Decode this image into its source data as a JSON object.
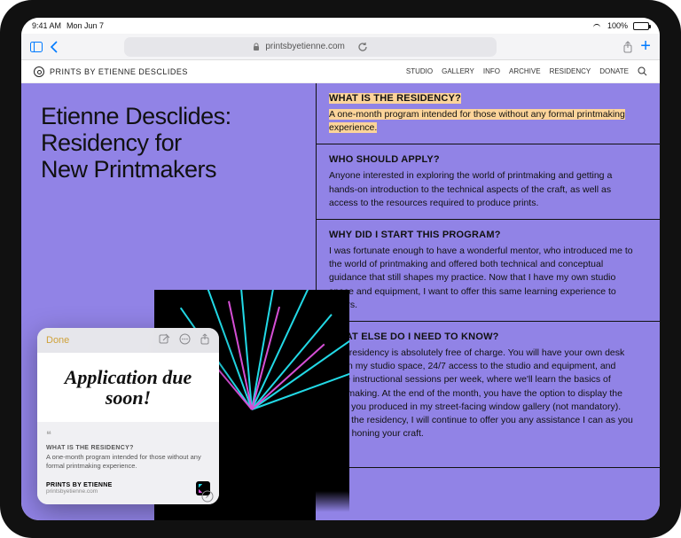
{
  "status": {
    "time": "9:41 AM",
    "date": "Mon Jun 7",
    "battery": "100%"
  },
  "safari": {
    "url": "printsbyetienne.com"
  },
  "site": {
    "brand": "PRINTS BY ETIENNE DESCLIDES",
    "nav": [
      "STUDIO",
      "GALLERY",
      "INFO",
      "ARCHIVE",
      "RESIDENCY",
      "DONATE"
    ]
  },
  "hero": {
    "title_lines": [
      "Etienne Desclides:",
      "Residency for",
      "New Printmakers"
    ]
  },
  "faq": [
    {
      "q": "WHAT IS THE RESIDENCY?",
      "a": "A one-month program intended for those without any formal printmaking experience.",
      "highlighted": true
    },
    {
      "q": "WHO SHOULD APPLY?",
      "a": "Anyone interested in exploring the world of printmaking and getting a hands-on introduction to the technical aspects of the craft, as well as access to the resources required to produce prints."
    },
    {
      "q": "WHY DID I START THIS PROGRAM?",
      "a": "I was fortunate enough to have a wonderful mentor, who introduced me to the world of printmaking and offered both technical and conceptual guidance that still shapes my practice. Now that I have my own studio space and equipment, I want to offer this same learning experience to others."
    },
    {
      "q": "WHAT ELSE DO I NEED TO KNOW?",
      "a": "This residency is absolutely free of charge. You will have your own desk within my studio space, 24/7 access to the studio and equipment, and three instructional sessions per week, where we'll learn the basics of printmaking. At the end of the month, you have the option to display the work you produced in my street-facing window gallery (not mandatory). After the residency, I will continue to offer you any assistance I can as you keep honing your craft."
    }
  ],
  "note": {
    "done": "Done",
    "handwriting": "Application due soon!",
    "snippet_heading": "WHAT IS THE RESIDENCY?",
    "snippet_body": "A one-month program intended for those without any formal printmaking experience.",
    "source_title": "PRINTS BY ETIENNE",
    "source_url": "printsbyetienne.com"
  }
}
